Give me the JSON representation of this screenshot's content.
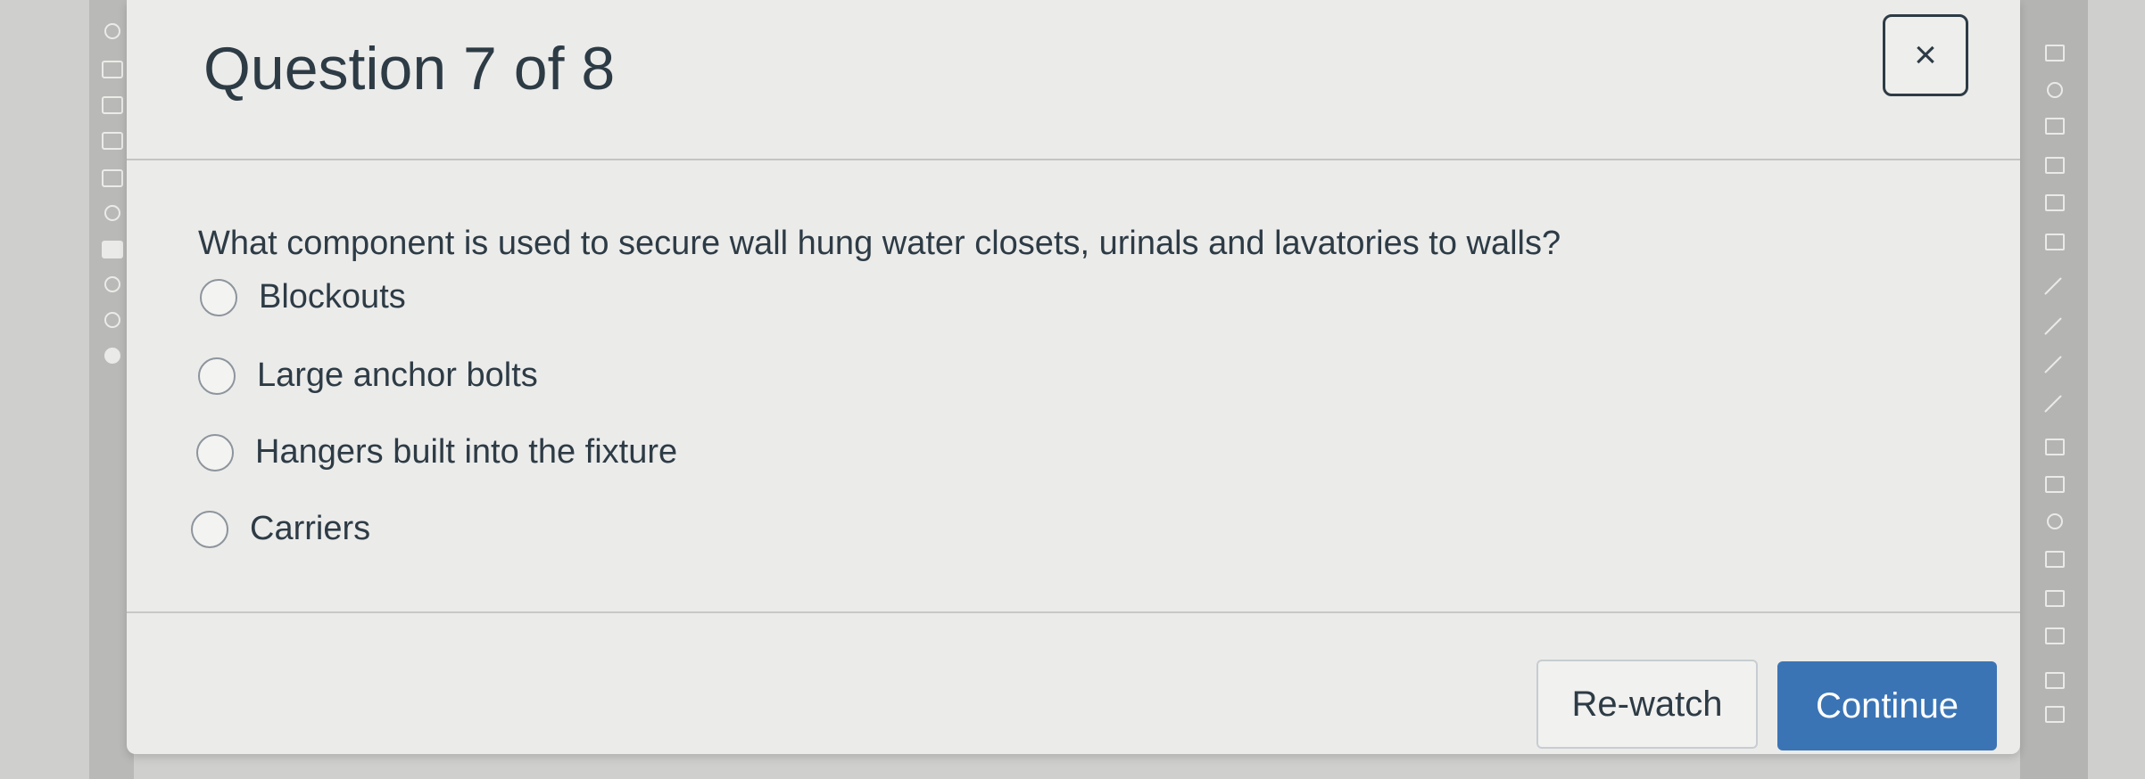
{
  "modal": {
    "title": "Question 7 of 8",
    "close_icon": "×"
  },
  "question": {
    "text": "What component is used to secure wall hung water closets, urinals and lavatories to walls?",
    "options": [
      {
        "label": "Blockouts",
        "selected": false
      },
      {
        "label": "Large anchor bolts",
        "selected": false
      },
      {
        "label": "Hangers built into the fixture",
        "selected": false
      },
      {
        "label": "Carriers",
        "selected": false
      }
    ]
  },
  "footer": {
    "rewatch_label": "Re-watch",
    "continue_label": "Continue"
  },
  "colors": {
    "accent": "#3b74b5",
    "text": "#2d3b45",
    "modal_bg": "#ebebea"
  },
  "icons": {
    "close": "close-icon",
    "radio": "radio-icon"
  }
}
